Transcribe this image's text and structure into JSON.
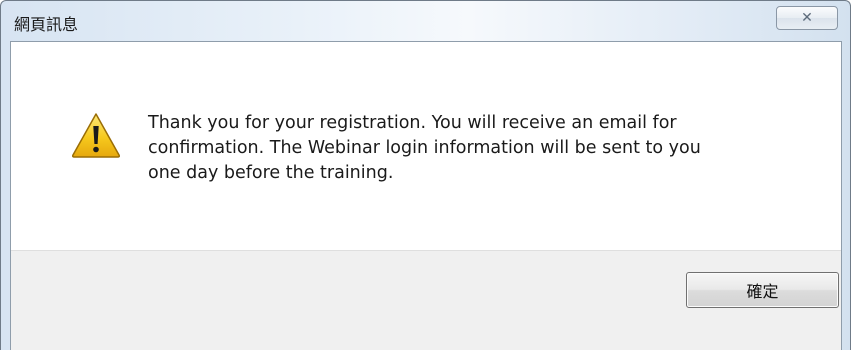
{
  "window": {
    "title": "網頁訊息",
    "close_glyph": "✕"
  },
  "dialog": {
    "icon": "warning-icon",
    "message_lines": [
      "Thank you for your registration. You will receive an email for",
      "confirmation. The Webinar login information will be sent to you",
      "one day before the training."
    ]
  },
  "footer": {
    "ok_label": "確定"
  },
  "colors": {
    "warning_fill": "#f3c21c",
    "footer_bg": "#f0f0f0"
  }
}
